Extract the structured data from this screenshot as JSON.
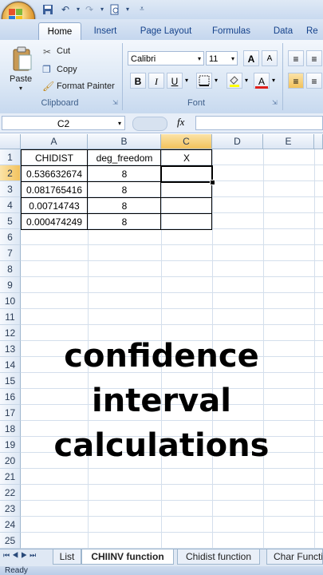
{
  "ribbon": {
    "tabs": [
      "Home",
      "Insert",
      "Page Layout",
      "Formulas",
      "Data",
      "Re"
    ],
    "clipboard": {
      "paste": "Paste",
      "cut": "Cut",
      "copy": "Copy",
      "format_painter": "Format Painter",
      "label": "Clipboard"
    },
    "font": {
      "name": "Calibri",
      "size": "11",
      "bold": "B",
      "italic": "I",
      "underline": "U",
      "grow": "A",
      "shrink": "A",
      "color": "A",
      "label": "Font"
    }
  },
  "formula_bar": {
    "name_box": "C2",
    "fx": "fx",
    "value": ""
  },
  "sheet": {
    "columns": [
      "A",
      "B",
      "C",
      "D",
      "E"
    ],
    "rows": [
      "1",
      "2",
      "3",
      "4",
      "5",
      "6",
      "7",
      "8",
      "9",
      "10",
      "11",
      "12",
      "13",
      "14",
      "15",
      "16",
      "17",
      "18",
      "19",
      "20",
      "21",
      "22",
      "23",
      "24",
      "25"
    ],
    "header": [
      "CHIDIST",
      "deg_freedom",
      "X"
    ],
    "data": [
      [
        "0.536632674",
        "8",
        ""
      ],
      [
        "0.081765416",
        "8",
        ""
      ],
      [
        "0.00714743",
        "8",
        ""
      ],
      [
        "0.000474249",
        "8",
        ""
      ]
    ],
    "selected_cell": "C2"
  },
  "overlay_text": [
    "confidence",
    "interval",
    "calculations"
  ],
  "sheet_tabs": [
    "List",
    "CHIINV function",
    "Chidist function",
    "Char Functi"
  ],
  "active_sheet": "CHIINV function",
  "status": "Ready",
  "colors": {
    "ribbon_blue": "#c4d6ee",
    "selection_orange": "#f2c25c",
    "grid": "#d4dfec"
  }
}
